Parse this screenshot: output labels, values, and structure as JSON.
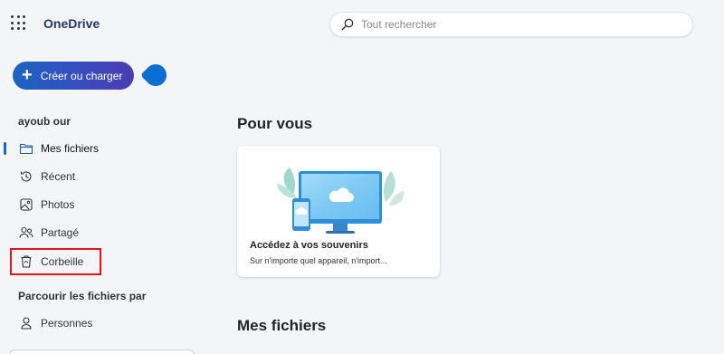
{
  "app": {
    "title": "OneDrive"
  },
  "search": {
    "placeholder": "Tout rechercher"
  },
  "create_button": {
    "label": "Créer ou charger"
  },
  "sidebar": {
    "user_name": "ayoub our",
    "items": [
      {
        "label": "Mes fichiers",
        "icon": "folder-icon",
        "active": true
      },
      {
        "label": "Récent",
        "icon": "clock-history-icon"
      },
      {
        "label": "Photos",
        "icon": "image-icon"
      },
      {
        "label": "Partagé",
        "icon": "people-icon"
      },
      {
        "label": "Corbeille",
        "icon": "trash-icon",
        "highlighted": true
      }
    ],
    "browse_heading": "Parcourir les fichiers par",
    "browse_items": [
      {
        "label": "Personnes",
        "icon": "person-icon"
      }
    ]
  },
  "main": {
    "for_you_heading": "Pour vous",
    "card": {
      "title": "Accédez à vos souvenirs",
      "subtitle": "Sur n'importe quel appareil, n'import..."
    },
    "my_files_heading": "Mes fichiers"
  },
  "colors": {
    "accent": "#0f6cbd",
    "brand_text": "#1e3a6e",
    "highlight_border": "#e3161b",
    "background": "#f4f5f7"
  }
}
